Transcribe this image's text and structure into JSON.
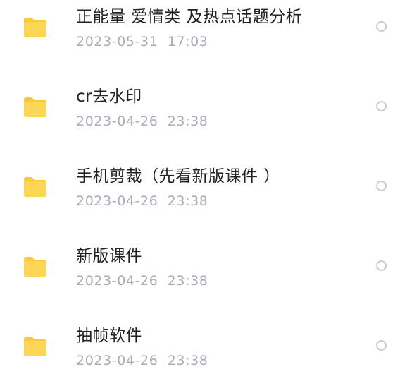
{
  "colors": {
    "folder_body": "#FDD655",
    "folder_back": "#F9C93E",
    "title_text": "#222222",
    "date_text": "#A7ACB6",
    "radio_border": "#C7CBD1"
  },
  "files": [
    {
      "name": "正能量 爱情类 及热点话题分析",
      "date": "2023-05-31  17:03",
      "icon": "folder-icon",
      "selected": false
    },
    {
      "name": "cr去水印",
      "date": "2023-04-26  23:38",
      "icon": "folder-icon",
      "selected": false
    },
    {
      "name": "手机剪裁（先看新版课件 ）",
      "date": "2023-04-26  23:38",
      "icon": "folder-icon",
      "selected": false
    },
    {
      "name": "新版课件",
      "date": "2023-04-26  23:38",
      "icon": "folder-icon",
      "selected": false
    },
    {
      "name": "抽帧软件",
      "date": "2023-04-26  23:38",
      "icon": "folder-icon",
      "selected": false
    }
  ]
}
